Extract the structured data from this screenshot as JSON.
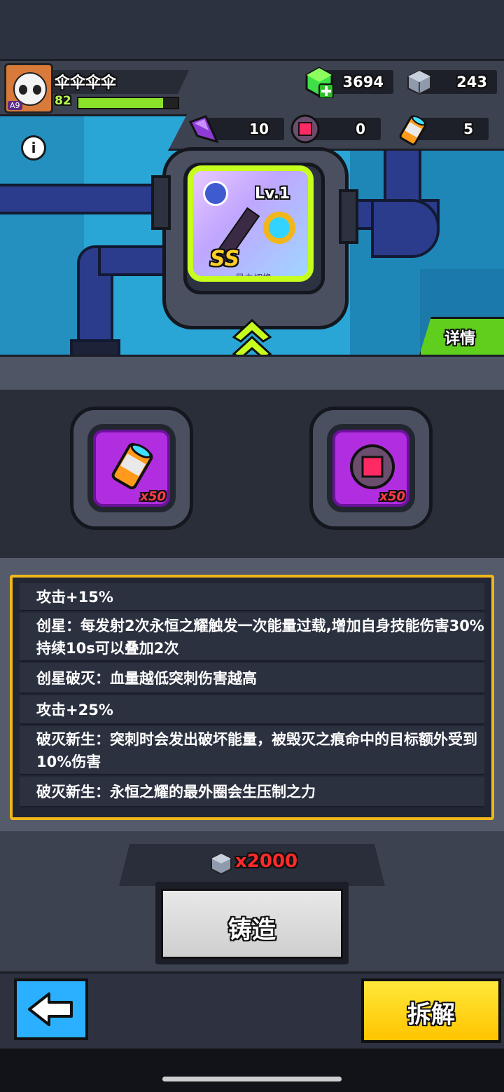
{
  "player": {
    "name": "伞伞伞伞",
    "level": "82",
    "avatar_tag": "A9",
    "xp_fraction": 0.85
  },
  "currencies": [
    {
      "icon": "green-gem-plus-icon",
      "value": "3694"
    },
    {
      "icon": "metal-cube-icon",
      "value": "243"
    }
  ],
  "materials": [
    {
      "icon": "purple-shard-icon",
      "value": "10"
    },
    {
      "icon": "red-core-icon",
      "value": "0"
    },
    {
      "icon": "orange-cylinder-icon",
      "value": "5"
    }
  ],
  "equipment": {
    "level": "Lv.1",
    "rank": "SS",
    "name": "星击切换"
  },
  "detail_label": "详情",
  "slots": [
    {
      "icon": "orange-cylinder-icon",
      "qty": "x50"
    },
    {
      "icon": "red-core-icon",
      "qty": "x50"
    }
  ],
  "stats": [
    "攻击+15%",
    "创星：每发射2次永恒之耀触发一次能量过载,增加自身技能伤害30%持续10s可以叠加2次",
    "创星破灭：血量越低突刺伤害越高",
    "攻击+25%",
    "破灭新生：突刺时会发出破坏能量，被毁灭之痕命中的目标额外受到10%伤害",
    "破灭新生：永恒之耀的最外圈会生压制之力"
  ],
  "cost": {
    "icon": "metal-cube-icon",
    "value": "x2000"
  },
  "forge_label": "铸造",
  "dismantle_label": "拆解",
  "colors": {
    "accent_green": "#c6ff1e",
    "panel_border": "#f0b71a",
    "cost_red": "#ff2a2a",
    "dismantle_yellow": "#ffd21a",
    "back_blue": "#2bb0ff"
  }
}
